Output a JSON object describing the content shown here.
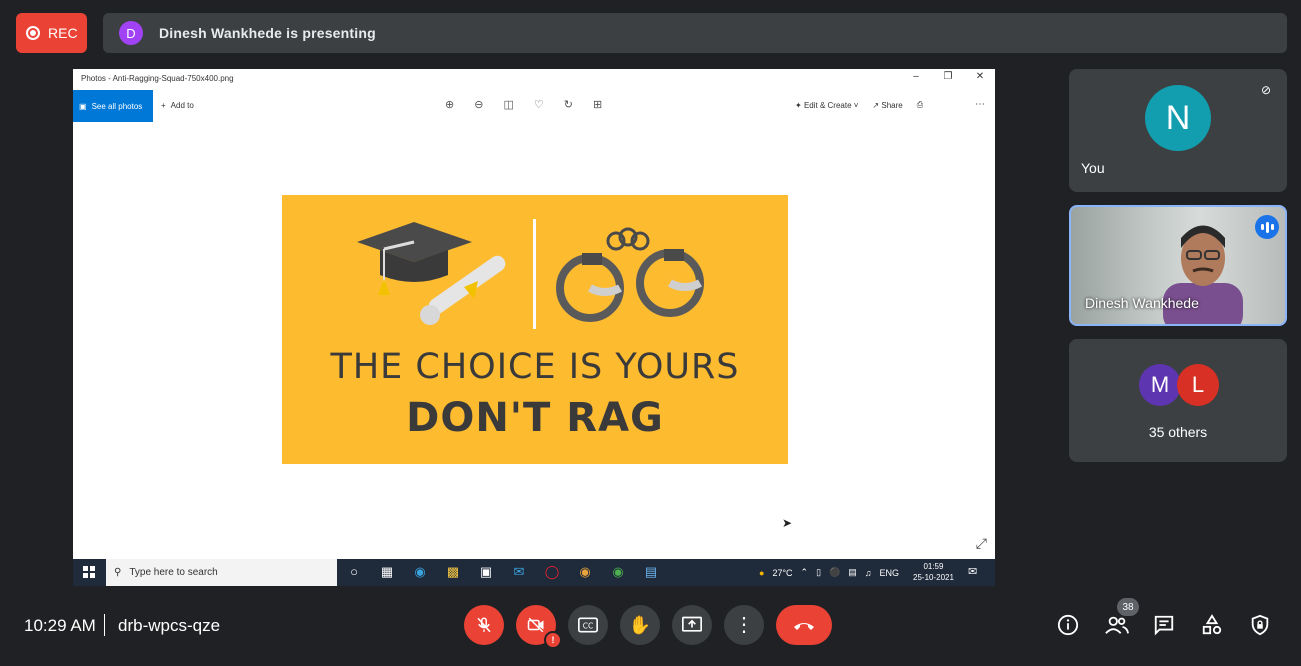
{
  "top": {
    "rec_label": "REC",
    "presenter_initial": "D",
    "presenting_text": "Dinesh Wankhede is presenting"
  },
  "shared_screen": {
    "window_title": "Photos - Anti-Ragging-Squad-750x400.png",
    "see_all_photos": "See all photos",
    "add_to": "Add to",
    "edit_create": "Edit & Create",
    "share": "Share",
    "poster": {
      "line1": "THE CHOICE IS YOURS",
      "line2": "DON'T RAG"
    },
    "taskbar": {
      "search_placeholder": "Type here to search",
      "temperature": "27°C",
      "language": "ENG",
      "time": "01:59",
      "date": "25-10-2021"
    }
  },
  "participants": {
    "you": {
      "initial": "N",
      "label": "You"
    },
    "presenter": {
      "label": "Dinesh Wankhede"
    },
    "others": {
      "initial_1": "M",
      "initial_2": "L",
      "label": "35 others"
    }
  },
  "bottom": {
    "time": "10:29 AM",
    "meeting_code": "drb-wpcs-qze",
    "people_count": "38"
  },
  "colors": {
    "background": "#202124",
    "tile": "#3c4043",
    "red": "#ea4335",
    "accent_blue": "#8ab4f8",
    "poster_yellow": "#fdbb30"
  }
}
